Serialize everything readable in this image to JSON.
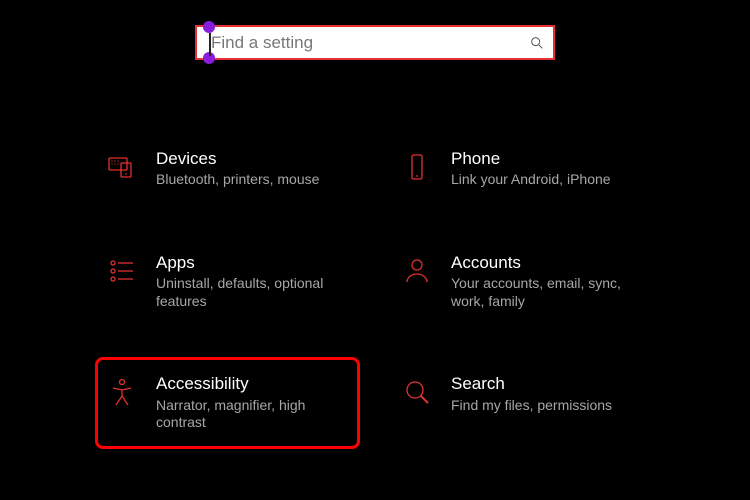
{
  "search": {
    "placeholder": "Find a setting",
    "value": ""
  },
  "tiles": {
    "devices": {
      "title": "Devices",
      "desc": "Bluetooth, printers, mouse"
    },
    "phone": {
      "title": "Phone",
      "desc": "Link your Android, iPhone"
    },
    "apps": {
      "title": "Apps",
      "desc": "Uninstall, defaults, optional features"
    },
    "accounts": {
      "title": "Accounts",
      "desc": "Your accounts, email, sync, work, family"
    },
    "accessibility": {
      "title": "Accessibility",
      "desc": "Narrator, magnifier, high contrast",
      "highlighted": true
    },
    "search": {
      "title": "Search",
      "desc": "Find my files, permissions"
    }
  },
  "colors": {
    "accent": "#e43030",
    "highlight_border": "#ff0000",
    "background": "#000000"
  }
}
